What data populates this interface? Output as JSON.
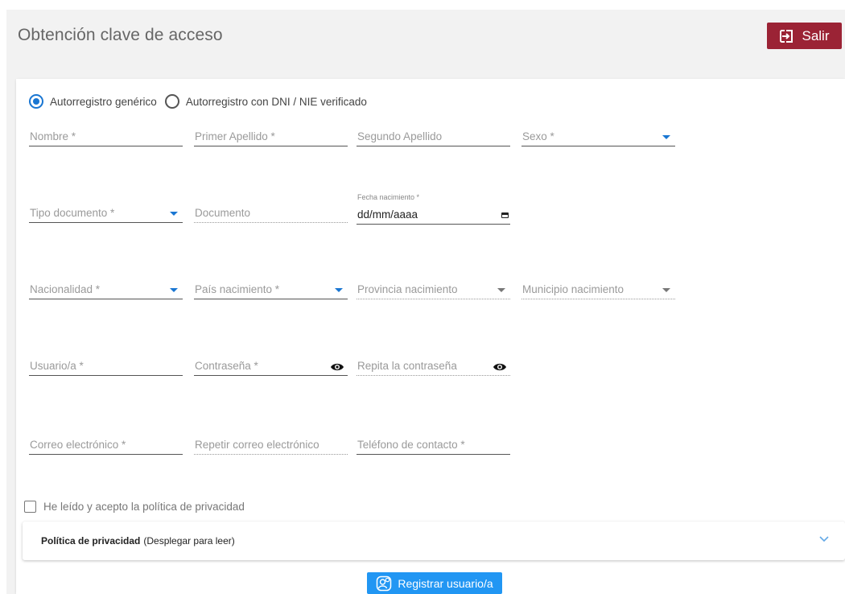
{
  "page": {
    "title": "Obtención clave de acceso"
  },
  "header": {
    "exit_label": "Salir"
  },
  "registration_type": {
    "options": [
      "Autorregistro genérico",
      "Autorregistro con DNI / NIE verificado"
    ],
    "selected": "Autorregistro genérico"
  },
  "fields": {
    "nombre": "Nombre *",
    "primer_apellido": "Primer Apellido *",
    "segundo_apellido": "Segundo Apellido",
    "sexo": "Sexo *",
    "tipo_documento": "Tipo documento *",
    "documento": "Documento",
    "fecha_nacimiento_label": "Fecha nacimiento *",
    "fecha_nacimiento_value": "dd/mm/aaaa",
    "nacionalidad": "Nacionalidad *",
    "pais_nacimiento": "País nacimiento *",
    "provincia_nacimiento": "Provincia nacimiento",
    "municipio_nacimiento": "Municipio nacimiento",
    "usuario": "Usuario/a *",
    "contrasena": "Contraseña *",
    "repita_contrasena": "Repita la contraseña",
    "correo": "Correo electrónico *",
    "repetir_correo": "Repetir correo electrónico",
    "telefono": "Teléfono de contacto *"
  },
  "privacy": {
    "checkbox_label": "He leído y acepto la política de privacidad",
    "checked": false,
    "accordion_title": "Política de privacidad",
    "accordion_hint": "(Desplegar para leer)"
  },
  "actions": {
    "register_label": "Registrar usuario/a"
  },
  "colors": {
    "accent": "#1976d2",
    "exit_button": "#9b2335",
    "register_button": "#2196f3"
  },
  "icons": [
    "exit-icon",
    "radio-icon",
    "dropdown-caret-icon",
    "calendar-icon",
    "eye-icon",
    "checkbox-icon",
    "chevron-down-icon",
    "user-add-icon"
  ]
}
